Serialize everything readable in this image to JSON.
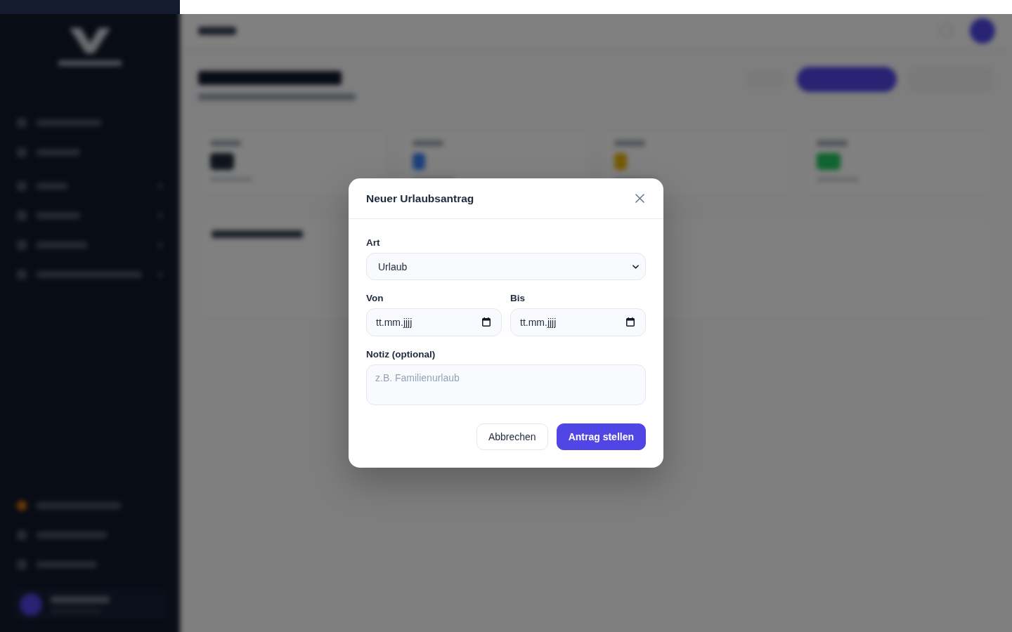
{
  "dialog": {
    "title": "Neuer Urlaubsantrag",
    "type_field": {
      "label": "Art",
      "value": "Urlaub"
    },
    "date_fields": [
      {
        "label": "Von",
        "placeholder": "tt.mm.jjjj"
      },
      {
        "label": "Bis",
        "placeholder": "tt.mm.jjjj"
      }
    ],
    "note_field": {
      "label": "Notiz (optional)",
      "placeholder": "z.B. Familienurlaub"
    },
    "buttons": [
      {
        "label": "Abbrechen",
        "kind": "secondary"
      },
      {
        "label": "Antrag stellen",
        "kind": "primary"
      }
    ]
  }
}
